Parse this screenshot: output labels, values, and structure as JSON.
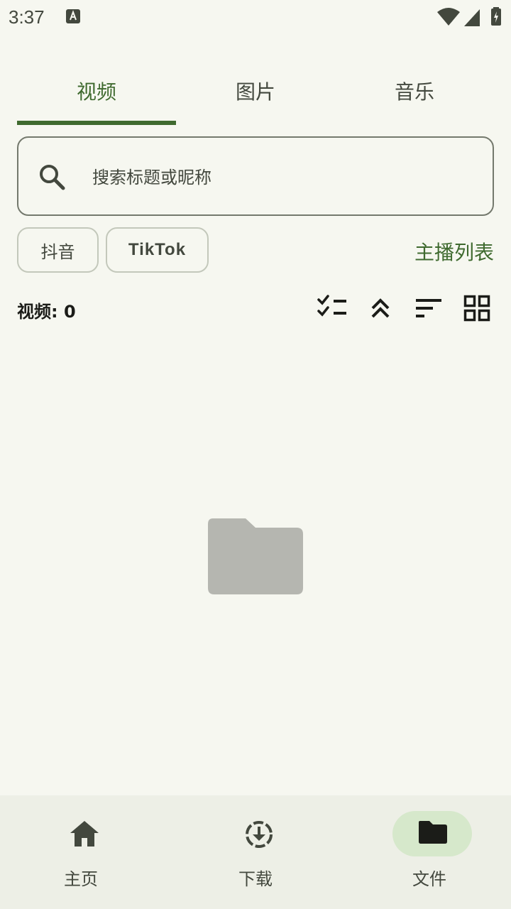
{
  "status_bar": {
    "time": "3:37",
    "icons": [
      "notification-a-icon",
      "wifi-icon",
      "signal-icon",
      "battery-charging-icon"
    ]
  },
  "tabs": [
    {
      "label": "视频",
      "active": true
    },
    {
      "label": "图片",
      "active": false
    },
    {
      "label": "音乐",
      "active": false
    }
  ],
  "search": {
    "placeholder": "搜索标题或昵称",
    "value": "",
    "icon": "search-icon"
  },
  "filters": {
    "chips": [
      {
        "label": "抖音"
      },
      {
        "label": "TikTok"
      }
    ],
    "streamer_list_label": "主播列表"
  },
  "toolbar": {
    "count_label": "视频: 0",
    "icons": [
      "checklist-icon",
      "collapse-all-icon",
      "sort-icon",
      "grid-view-icon"
    ]
  },
  "empty_state": {
    "icon": "folder-icon"
  },
  "bottom_nav": {
    "items": [
      {
        "label": "主页",
        "icon": "home-icon",
        "active": false
      },
      {
        "label": "下载",
        "icon": "download-icon",
        "active": false
      },
      {
        "label": "文件",
        "icon": "folder-icon",
        "active": true
      }
    ]
  },
  "colors": {
    "background": "#f6f7f0",
    "accent": "#3f6a2f",
    "nav_background": "#edefe6",
    "active_pill": "#d6e8cb",
    "empty_icon": "#b5b6b0"
  }
}
